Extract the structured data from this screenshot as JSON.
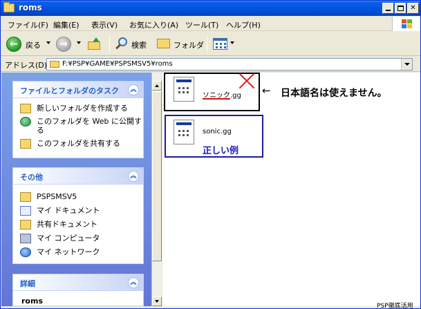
{
  "window": {
    "title": "roms"
  },
  "menu": [
    "ファイル(F)",
    "編集(E)",
    "表示(V)",
    "お気に入り(A)",
    "ツール(T)",
    "ヘルプ(H)"
  ],
  "toolbar": {
    "back_label": "戻る",
    "search_label": "検索",
    "folders_label": "フォルダ"
  },
  "address": {
    "label": "アドレス(D)",
    "value": "F:¥PSP¥GAME¥PSPSMSV5¥roms"
  },
  "tasks_panel": {
    "title": "ファイルとフォルダのタスク",
    "items": [
      "新しいフォルダを作成する",
      "このフォルダを Web に公開す",
      "る",
      "このフォルダを共有する"
    ]
  },
  "other_panel": {
    "title": "その他",
    "items": [
      "PSPSMSV5",
      "マイ ドキュメント",
      "共有ドキュメント",
      "マイ コンピュータ",
      "マイ ネットワーク"
    ]
  },
  "details_panel": {
    "title": "詳細",
    "name": "roms"
  },
  "files": [
    {
      "name": "ソニック.gg"
    },
    {
      "name": "sonic.gg"
    }
  ],
  "annotations": {
    "arrow": "←",
    "wrong_note": "日本語名は使えません。",
    "correct_label": "正しい例",
    "credit": "PSP徹底活用"
  },
  "colors": {
    "title_bar": "#0054e3",
    "task_pane": "#7ba2e7",
    "panel_header_text": "#215dc6",
    "error_mark": "#e02020",
    "correct_box": "#1a1aa0"
  }
}
